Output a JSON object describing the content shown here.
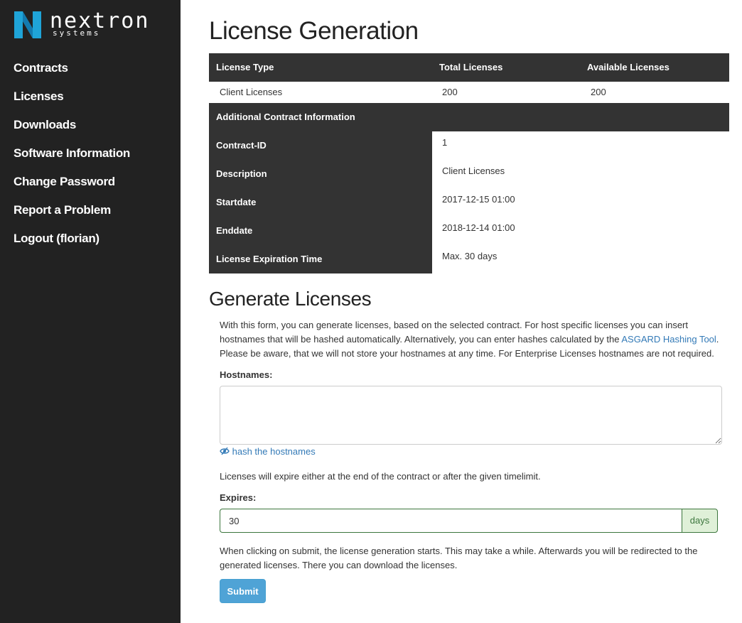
{
  "brand": {
    "name": "nextron",
    "sub": "systems",
    "colors": {
      "logo_blue": "#1fa4d8",
      "sidebar": "#222222"
    }
  },
  "nav": [
    {
      "label": "Contracts"
    },
    {
      "label": "Licenses"
    },
    {
      "label": "Downloads"
    },
    {
      "label": "Software Information"
    },
    {
      "label": "Change Password"
    },
    {
      "label": "Report a Problem"
    },
    {
      "label": "Logout (florian)"
    }
  ],
  "page_title": "License Generation",
  "license_table": {
    "headers": [
      "License Type",
      "Total Licenses",
      "Available Licenses"
    ],
    "row": [
      "Client Licenses",
      "200",
      "200"
    ]
  },
  "contract_info": {
    "heading": "Additional Contract Information",
    "fields": [
      {
        "key": "Contract-ID",
        "value": "1"
      },
      {
        "key": "Description",
        "value": "Client Licenses"
      },
      {
        "key": "Startdate",
        "value": "2017-12-15 01:00"
      },
      {
        "key": "Enddate",
        "value": "2018-12-14 01:00"
      },
      {
        "key": "License Expiration Time",
        "value": "Max. 30 days"
      }
    ]
  },
  "generate": {
    "heading": "Generate Licenses",
    "intro_part1": "With this form, you can generate licenses, based on the selected contract. For host specific licenses you can insert hostnames that will be hashed automatically. Alternatively, you can enter hashes calculated by the ",
    "intro_link": "ASGARD Hashing Tool",
    "intro_part2": ". Please be aware, that we will not store your hostnames at any time. For Enterprise Licenses hostnames are not required.",
    "hostnames_label": "Hostnames:",
    "hostnames_value": "",
    "hash_link": "hash the hostnames",
    "expire_note": "Licenses will expire either at the end of the contract or after the given timelimit.",
    "expires_label": "Expires:",
    "expires_value": "30",
    "expires_unit": "days",
    "submit_note": "When clicking on submit, the license generation starts. This may take a while. Afterwards you will be redirected to the generated licenses. There you can download the licenses.",
    "submit_label": "Submit"
  }
}
